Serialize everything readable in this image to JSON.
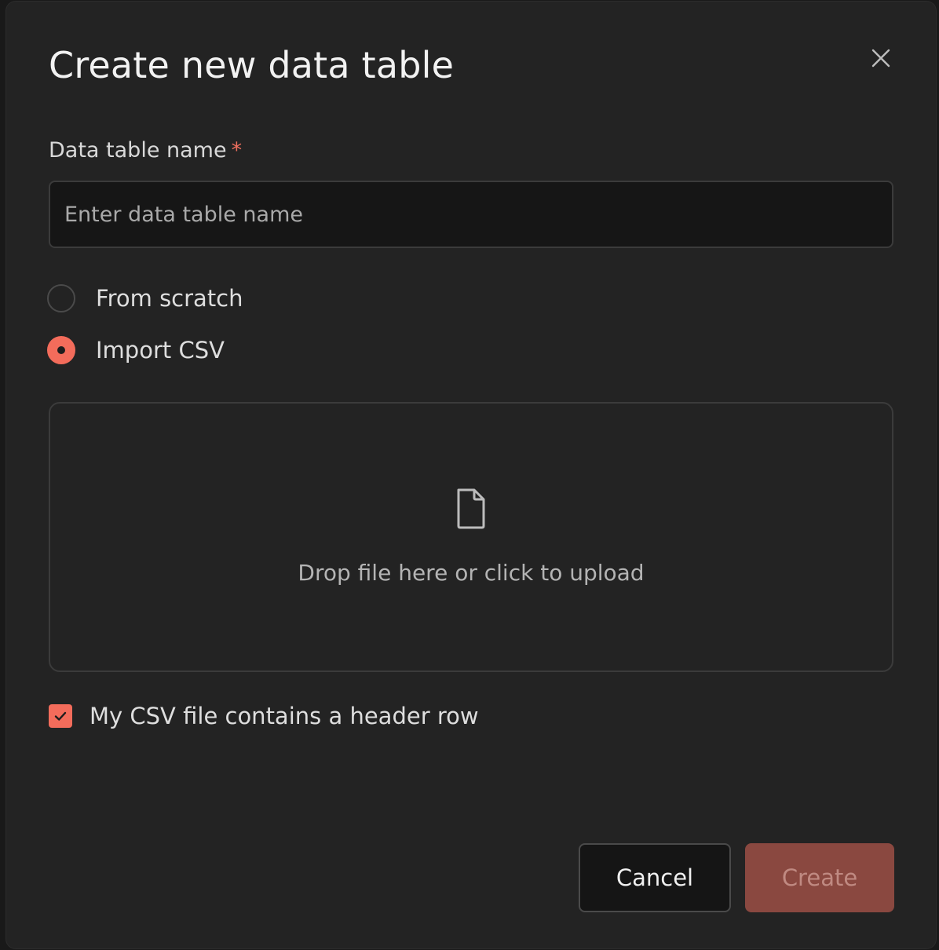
{
  "dialog": {
    "title": "Create new data table",
    "close_icon": "close-icon"
  },
  "form": {
    "name_label": "Data table name",
    "required_marker": "*",
    "name_input": {
      "value": "",
      "placeholder": "Enter data table name"
    },
    "source_options": [
      {
        "label": "From scratch",
        "checked": false
      },
      {
        "label": "Import CSV",
        "checked": true
      }
    ],
    "dropzone": {
      "icon": "file-icon",
      "text": "Drop file here or click to upload"
    },
    "header_row_checkbox": {
      "label": "My CSV file contains a header row",
      "checked": true
    }
  },
  "actions": {
    "cancel_label": "Cancel",
    "create_label": "Create"
  },
  "colors": {
    "accent": "#f36c5b",
    "background": "#232323",
    "create_disabled": "#8a4840"
  }
}
